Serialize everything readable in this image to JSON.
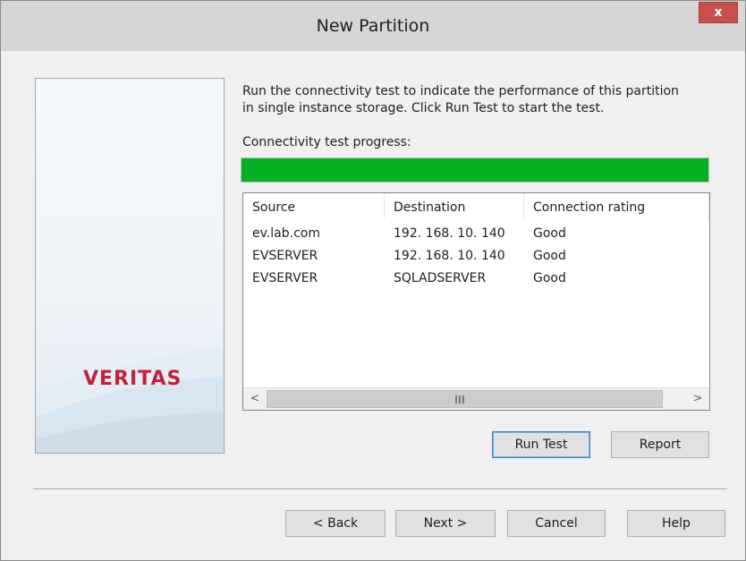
{
  "window": {
    "title": "New Partition",
    "close_label": "x"
  },
  "brand": {
    "logo_text": "VERITAS",
    "logo_color": "#c0223a"
  },
  "intro": {
    "line1": "Run the connectivity test to indicate the performance of this partition",
    "line2": "in single instance storage.  Click Run Test to start the test."
  },
  "progress": {
    "label": "Connectivity test progress:",
    "value_percent": 100,
    "color": "#06b025"
  },
  "table": {
    "columns": [
      "Source",
      "Destination",
      "Connection rating"
    ],
    "rows": [
      [
        "ev.lab.com",
        "192. 168. 10. 140",
        "Good"
      ],
      [
        "EVSERVER",
        "192. 168. 10. 140",
        "Good"
      ],
      [
        "EVSERVER",
        "SQLADSERVER",
        "Good"
      ]
    ],
    "scroll_left": "<",
    "scroll_right": ">"
  },
  "buttons": {
    "run_test": "Run Test",
    "report": "Report",
    "back": "< Back",
    "next": "Next >",
    "cancel": "Cancel",
    "help": "Help"
  }
}
